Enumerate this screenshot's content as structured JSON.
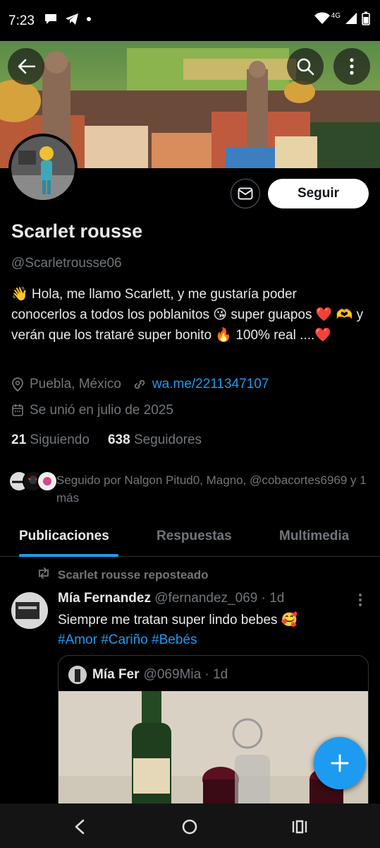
{
  "status_bar": {
    "time": "7:23",
    "network": "4G"
  },
  "profile": {
    "name": "Scarlet rousse",
    "handle": "@Scarletrousse06",
    "bio": "👋 Hola, me llamo Scarlett, y me gustaría poder conocerlos a todos los poblanitos 😘 super guapos ❤️ 🫶 y verán que los trataré super bonito 🔥 100% real ....❤️",
    "location": "Puebla, México",
    "website": "wa.me/2211347107",
    "joined": "Se unió en julio de 2025",
    "following_count": "21",
    "following_label": "Siguiendo",
    "followers_count": "638",
    "followers_label": "Seguidores",
    "followed_by": "Seguido por Nalgon Pitud0, Magno, @cobacortes6969 y 1 más",
    "follow_label": "Seguir"
  },
  "tabs": [
    {
      "label": "Publicaciones",
      "active": true
    },
    {
      "label": "Respuestas",
      "active": false
    },
    {
      "label": "Multimedia",
      "active": false
    }
  ],
  "post": {
    "repost_label": "Scarlet rousse reposteado",
    "author_name": "Mía Fernandez",
    "author_handle": "@fernandez_069",
    "time": "· 1d",
    "text": "Siempre me tratan super lindo bebes 🥰",
    "hashtags": "#Amor #Cariño #Bebés",
    "quote": {
      "author_name": "Mía Fer",
      "author_handle": "@069Mia",
      "time": "· 1d"
    }
  },
  "colors": {
    "accent": "#1d9bf0",
    "background": "#000000",
    "muted": "#71767b",
    "text": "#e7e9ea"
  },
  "icons": [
    "back-icon",
    "search-icon",
    "more-icon",
    "envelope-icon",
    "location-icon",
    "link-icon",
    "calendar-icon",
    "repost-icon",
    "plus-icon",
    "nav-back-icon",
    "nav-home-icon",
    "nav-recents-icon"
  ]
}
